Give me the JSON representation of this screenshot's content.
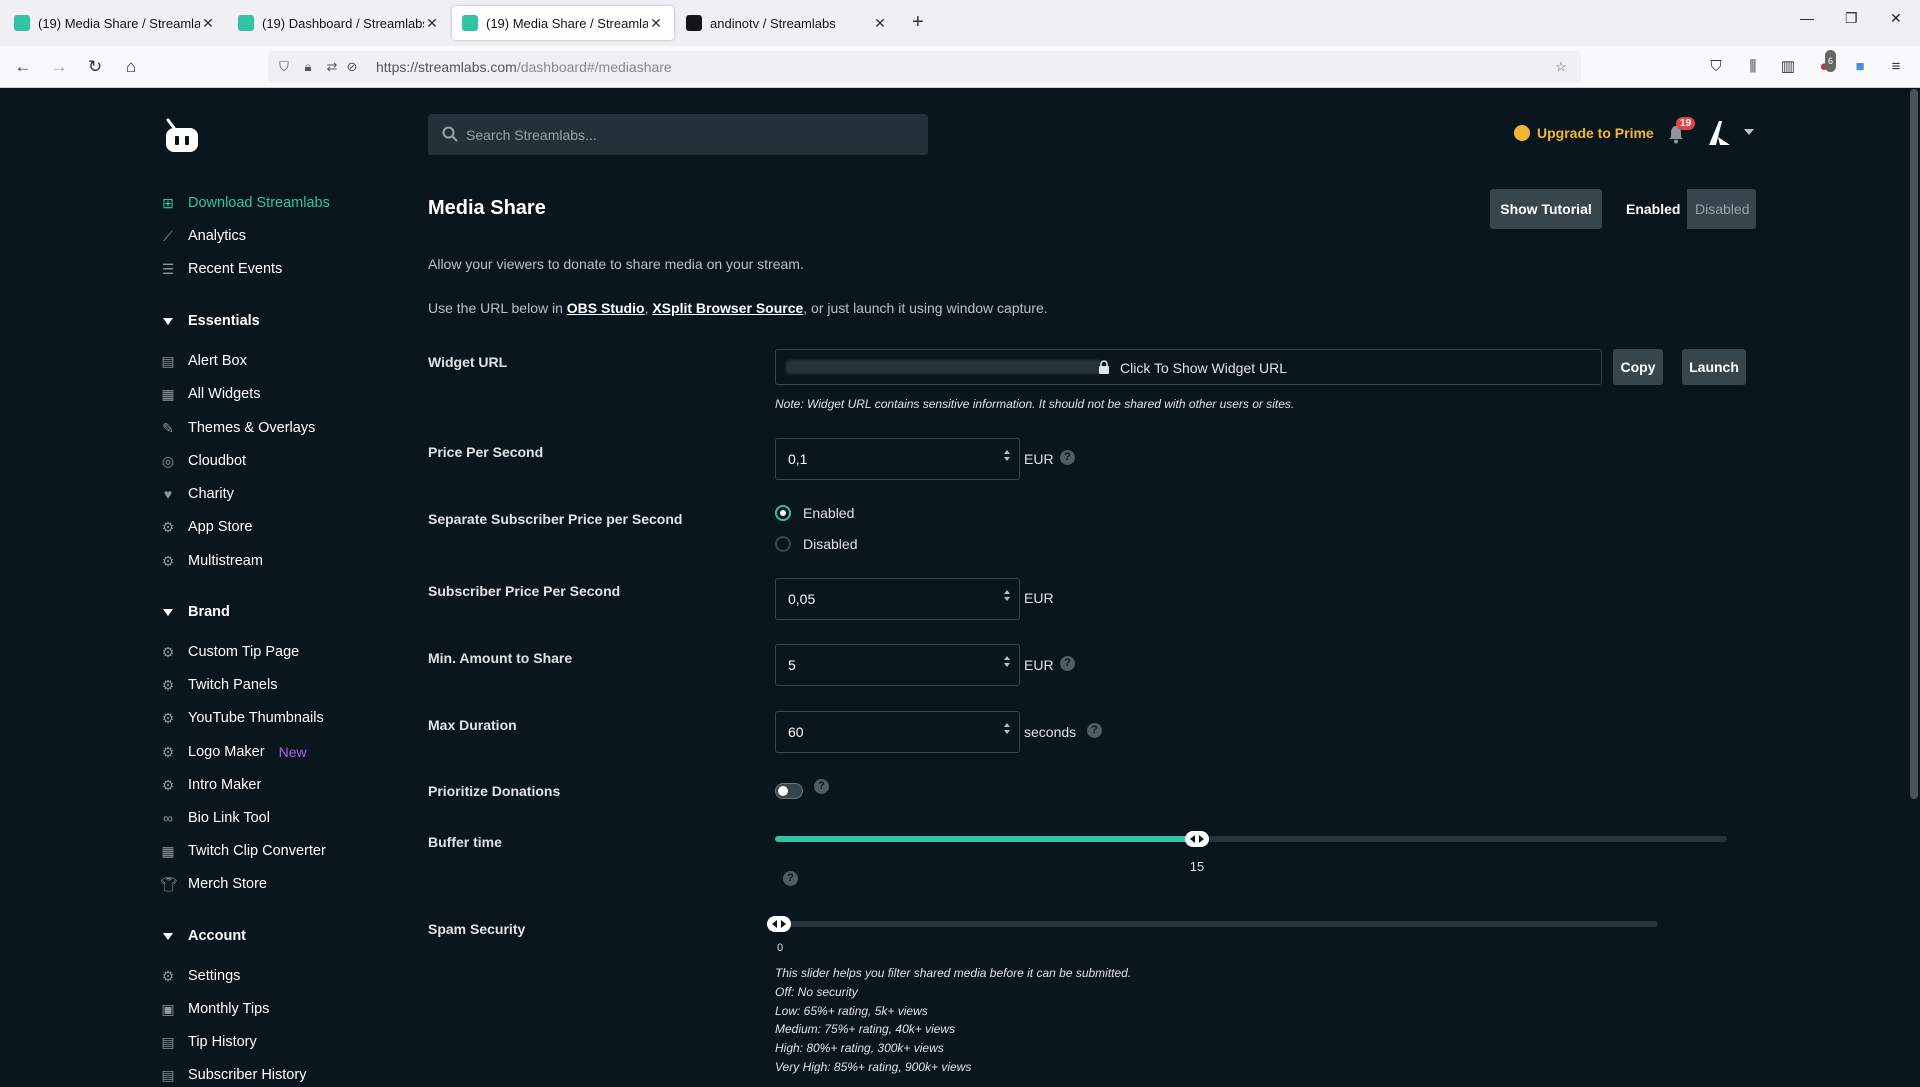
{
  "browser": {
    "tabs": [
      {
        "title": "(19) Media Share / Streamlabs",
        "active": false
      },
      {
        "title": "(19) Dashboard / Streamlabs",
        "active": false
      },
      {
        "title": "(19) Media Share / Streamlabs",
        "active": true
      },
      {
        "title": "andinotv / Streamlabs",
        "active": false
      }
    ],
    "url_host": "https://streamlabs.com",
    "url_path": "/dashboard#/mediashare",
    "extension_badge": "6"
  },
  "header": {
    "search_placeholder": "Search Streamlabs...",
    "upgrade_label": "Upgrade to Prime",
    "notification_count": "19",
    "accent_color": "#31c3a2",
    "prime_color": "#f2b632"
  },
  "sidebar": {
    "top_items": [
      {
        "label": "Download Streamlabs",
        "icon": "windows-icon",
        "highlight": true
      },
      {
        "label": "Analytics",
        "icon": "chart-icon"
      },
      {
        "label": "Recent Events",
        "icon": "list-icon"
      }
    ],
    "essentials": {
      "title": "Essentials",
      "items": [
        {
          "label": "Alert Box",
          "icon": "alert-box-icon"
        },
        {
          "label": "All Widgets",
          "icon": "widgets-icon"
        },
        {
          "label": "Themes & Overlays",
          "icon": "brush-icon"
        },
        {
          "label": "Cloudbot",
          "icon": "cloudbot-icon"
        },
        {
          "label": "Charity",
          "icon": "heart-icon"
        },
        {
          "label": "App Store",
          "icon": "app-store-icon"
        },
        {
          "label": "Multistream",
          "icon": "multistream-icon"
        }
      ]
    },
    "brand": {
      "title": "Brand",
      "items": [
        {
          "label": "Custom Tip Page",
          "icon": "tip-page-icon"
        },
        {
          "label": "Twitch Panels",
          "icon": "panels-icon"
        },
        {
          "label": "YouTube Thumbnails",
          "icon": "thumbnails-icon"
        },
        {
          "label": "Logo Maker",
          "icon": "logo-maker-icon",
          "tag": "New"
        },
        {
          "label": "Intro Maker",
          "icon": "intro-maker-icon"
        },
        {
          "label": "Bio Link Tool",
          "icon": "link-icon"
        },
        {
          "label": "Twitch Clip Converter",
          "icon": "clip-icon"
        },
        {
          "label": "Merch Store",
          "icon": "shirt-icon"
        }
      ]
    },
    "account": {
      "title": "Account",
      "items": [
        {
          "label": "Settings",
          "icon": "gear-icon"
        },
        {
          "label": "Monthly Tips",
          "icon": "calendar-icon"
        },
        {
          "label": "Tip History",
          "icon": "history-icon"
        },
        {
          "label": "Subscriber History",
          "icon": "subscriber-icon"
        }
      ]
    }
  },
  "main": {
    "title": "Media Share",
    "tutorial_label": "Show Tutorial",
    "enabled_label": "Enabled",
    "disabled_label": "Disabled",
    "desc1": "Allow your viewers to donate to share media on your stream.",
    "desc2_prefix": "Use the URL below in ",
    "desc2_link1": "OBS Studio",
    "desc2_sep": ", ",
    "desc2_link2": "XSplit Browser Source",
    "desc2_suffix": ", or just launch it using window capture.",
    "widget_url": {
      "label": "Widget URL",
      "show_text": "Click To Show Widget URL",
      "copy_label": "Copy",
      "launch_label": "Launch",
      "note": "Note: Widget URL contains sensitive information. It should not be shared with other users or sites."
    },
    "price_per_second": {
      "label": "Price Per Second",
      "value": "0,1",
      "unit": "EUR"
    },
    "separate_sub_price": {
      "label": "Separate Subscriber Price per Second",
      "option_enabled": "Enabled",
      "option_disabled": "Disabled",
      "selected": "Enabled"
    },
    "sub_price_per_second": {
      "label": "Subscriber Price Per Second",
      "value": "0,05",
      "unit": "EUR"
    },
    "min_amount": {
      "label": "Min. Amount to Share",
      "value": "5",
      "unit": "EUR"
    },
    "max_duration": {
      "label": "Max Duration",
      "value": "60",
      "unit": "seconds"
    },
    "prioritize_donations": {
      "label": "Prioritize Donations",
      "on": false
    },
    "buffer_time": {
      "label": "Buffer time",
      "value": "15",
      "fraction": 0.443
    },
    "spam_security": {
      "label": "Spam Security",
      "value": "0",
      "fraction": 0,
      "notes": [
        "This slider helps you filter shared media before it can be submitted.",
        "Off: No security",
        "Low: 65%+ rating, 5k+ views",
        "Medium: 75%+ rating, 40k+ views",
        "High: 80%+ rating, 300k+ views",
        "Very High: 85%+ rating, 900k+ views"
      ]
    }
  }
}
